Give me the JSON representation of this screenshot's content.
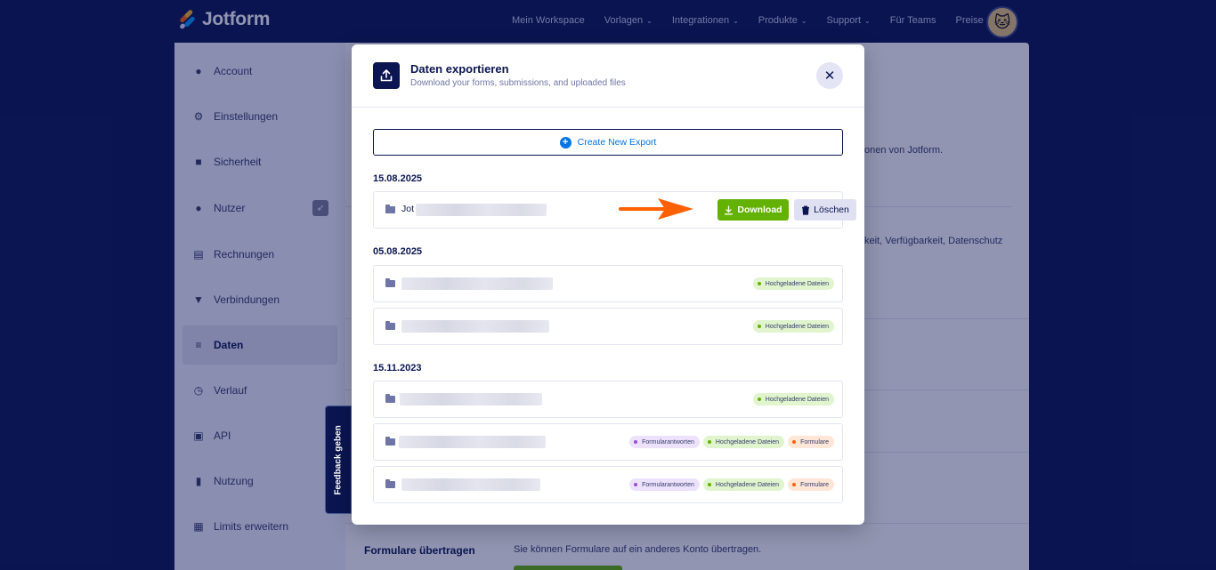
{
  "nav": {
    "logo": "Jotform",
    "items": [
      {
        "label": "Mein Workspace",
        "dropdown": false
      },
      {
        "label": "Vorlagen",
        "dropdown": true
      },
      {
        "label": "Integrationen",
        "dropdown": true
      },
      {
        "label": "Produkte",
        "dropdown": true
      },
      {
        "label": "Support",
        "dropdown": true
      },
      {
        "label": "Für Teams",
        "dropdown": false
      },
      {
        "label": "Preise",
        "dropdown": false
      }
    ]
  },
  "sidebar": {
    "items": [
      {
        "label": "Account",
        "icon": "user-icon"
      },
      {
        "label": "Einstellungen",
        "icon": "gear-icon"
      },
      {
        "label": "Sicherheit",
        "icon": "lock-icon"
      },
      {
        "label": "Nutzer",
        "icon": "users-icon"
      },
      {
        "label": "Rechnungen",
        "icon": "invoice-icon"
      },
      {
        "label": "Verbindungen",
        "icon": "plug-icon"
      },
      {
        "label": "Daten",
        "icon": "database-icon"
      },
      {
        "label": "Verlauf",
        "icon": "history-icon"
      },
      {
        "label": "API",
        "icon": "api-icon"
      },
      {
        "label": "Nutzung",
        "icon": "bar-chart-icon"
      },
      {
        "label": "Limits erweitern",
        "icon": "gift-icon"
      }
    ],
    "active": "Daten"
  },
  "background": {
    "text1": "onen von Jotform.",
    "text2": "keit, Verfügbarkeit, Datenschutz",
    "transfer_title": "Formulare übertragen",
    "transfer_desc": "Sie können Formulare auf ein anderes Konto übertragen."
  },
  "feedback": {
    "label": "Feedback geben"
  },
  "modal": {
    "title": "Daten exportieren",
    "subtitle": "Download your forms, submissions, and uploaded files",
    "create_label": "Create New Export",
    "download_label": "Download",
    "delete_label": "Löschen",
    "groups": [
      {
        "date": "15.08.2025",
        "exports": [
          {
            "name_prefix": "Jot",
            "tags": []
          }
        ]
      },
      {
        "date": "05.08.2025",
        "exports": [
          {
            "name_prefix": "",
            "tags": [
              {
                "label": "Hochgeladene Dateien",
                "color": "green"
              }
            ]
          },
          {
            "name_prefix": "",
            "tags": [
              {
                "label": "Hochgeladene Dateien",
                "color": "green"
              }
            ]
          }
        ]
      },
      {
        "date": "15.11.2023",
        "exports": [
          {
            "name_prefix": "",
            "tags": [
              {
                "label": "Hochgeladene Dateien",
                "color": "green"
              }
            ]
          },
          {
            "name_prefix": "",
            "tags": [
              {
                "label": "Formularantworten",
                "color": "purple"
              },
              {
                "label": "Hochgeladene Dateien",
                "color": "green"
              },
              {
                "label": "Formulare",
                "color": "orange"
              }
            ]
          },
          {
            "name_prefix": "",
            "tags": [
              {
                "label": "Formularantworten",
                "color": "purple"
              },
              {
                "label": "Hochgeladene Dateien",
                "color": "green"
              },
              {
                "label": "Formulare",
                "color": "orange"
              }
            ]
          }
        ]
      }
    ]
  },
  "colors": {
    "brand": "#0a1551",
    "accent": "#0075e3",
    "download": "#64b200",
    "arrow": "#ff6100"
  }
}
